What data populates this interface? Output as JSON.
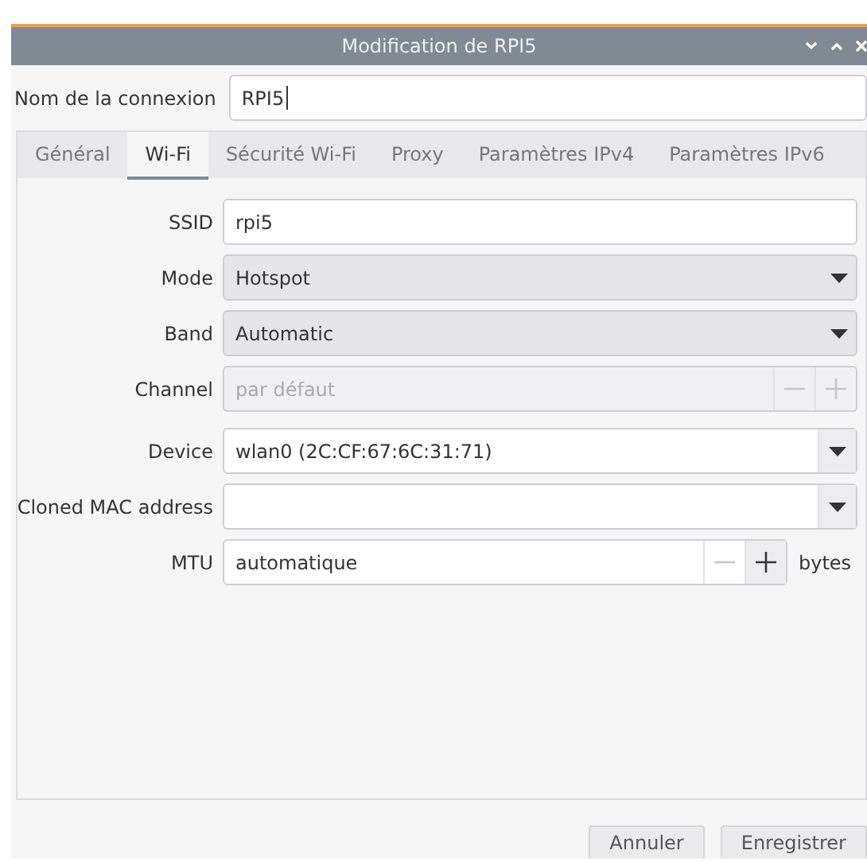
{
  "window": {
    "title": "Modification de RPI5"
  },
  "connection_name": {
    "label": "Nom de la connexion",
    "value": "RPI5"
  },
  "tabs": [
    {
      "label": "Général",
      "selected": false
    },
    {
      "label": "Wi-Fi",
      "selected": true
    },
    {
      "label": "Sécurité Wi-Fi",
      "selected": false
    },
    {
      "label": "Proxy",
      "selected": false
    },
    {
      "label": "Paramètres IPv4",
      "selected": false
    },
    {
      "label": "Paramètres IPv6",
      "selected": false
    }
  ],
  "fields": [
    {
      "kind": "text",
      "label": "SSID",
      "value": "rpi5",
      "disabled": false
    },
    {
      "kind": "combo",
      "label": "Mode",
      "value": "Hotspot",
      "disabled": false
    },
    {
      "kind": "combo",
      "label": "Band",
      "value": "Automatic",
      "disabled": false
    },
    {
      "kind": "spin",
      "label": "Channel",
      "placeholder": "par défaut",
      "disabled": true,
      "decrement_disabled": true,
      "increment_disabled": true
    },
    {
      "kind": "combo_entry",
      "label": "Device",
      "value": "wlan0 (2C:CF:67:6C:31:71)",
      "disabled": false
    },
    {
      "kind": "combo_entry",
      "label": "Cloned MAC address",
      "disabled": false
    },
    {
      "kind": "spin",
      "label": "MTU",
      "value": "automatique",
      "disabled": false,
      "decrement_disabled": true,
      "increment_disabled": false,
      "unit": "bytes"
    }
  ],
  "buttons": [
    "Annuler",
    "Enregistrer"
  ]
}
